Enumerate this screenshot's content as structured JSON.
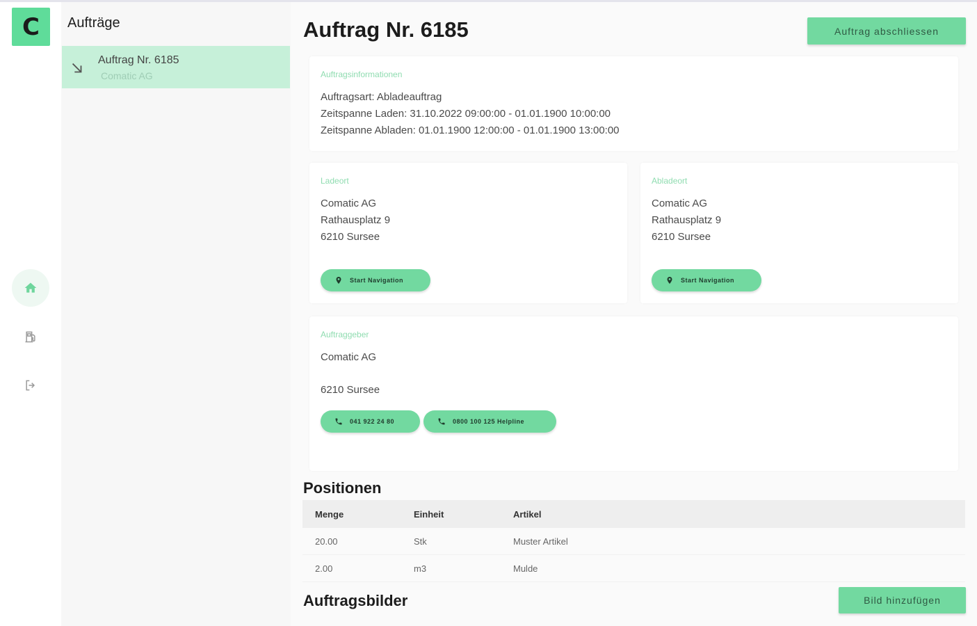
{
  "app": {
    "logo_letter": "C",
    "accent_color": "#72d9a0"
  },
  "rail": {
    "items": [
      {
        "icon": "home-icon",
        "active": true
      },
      {
        "icon": "fuel-icon",
        "active": false
      },
      {
        "icon": "logout-icon",
        "active": false
      }
    ]
  },
  "list": {
    "title": "Aufträge",
    "items": [
      {
        "icon": "arrow-down-right-icon",
        "title": "Auftrag Nr. 6185",
        "subtitle": "Comatic AG"
      }
    ]
  },
  "header": {
    "title": "Auftrag Nr. 6185",
    "close_button": "Auftrag abschliessen"
  },
  "info_card": {
    "title": "Auftragsinformationen",
    "lines": [
      "Auftragsart: Abladeauftrag",
      "Zeitspanne Laden: 31.10.2022 09:00:00 - 01.01.1900 10:00:00",
      "Zeitspanne Abladen: 01.01.1900 12:00:00 - 01.01.1900 13:00:00"
    ]
  },
  "ladeort": {
    "title": "Ladeort",
    "lines": [
      "Comatic AG",
      "Rathausplatz 9",
      "6210 Sursee"
    ],
    "nav_button": "Start Navigation"
  },
  "abladeort": {
    "title": "Abladeort",
    "lines": [
      "Comatic AG",
      "Rathausplatz 9",
      "6210 Sursee"
    ],
    "nav_button": "Start Navigation"
  },
  "auftraggeber": {
    "title": "Auftraggeber",
    "name": "Comatic AG",
    "city": "6210 Sursee",
    "phone_button": "041 922 24 80",
    "helpline_button": "0800 100 125 Helpline"
  },
  "positionen": {
    "title": "Positionen",
    "columns": [
      "Menge",
      "Einheit",
      "Artikel"
    ],
    "rows": [
      [
        "20.00",
        "Stk",
        "Muster Artikel"
      ],
      [
        "2.00",
        "m3",
        "Mulde"
      ]
    ]
  },
  "bilder": {
    "title": "Auftragsbilder",
    "add_button": "Bild hinzufügen"
  }
}
